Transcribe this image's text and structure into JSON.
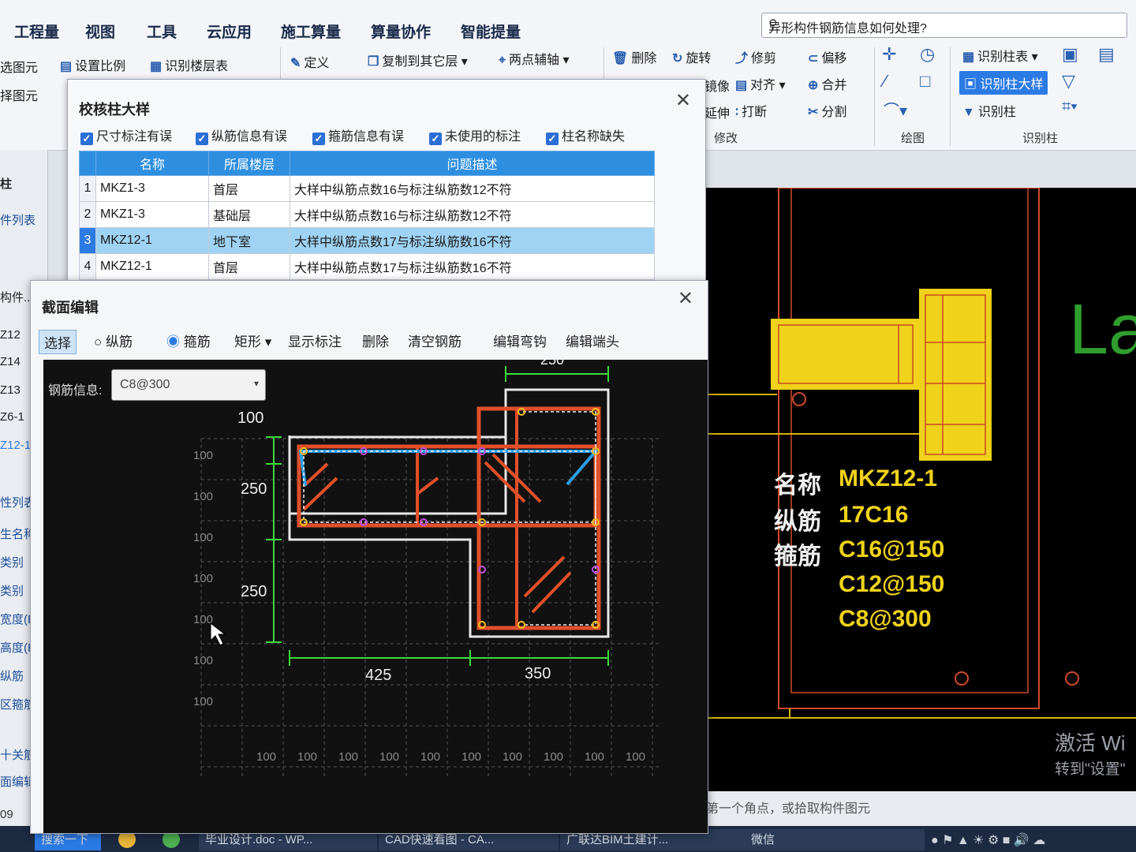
{
  "menu": [
    "工程量",
    "视图",
    "工具",
    "云应用",
    "施工算量",
    "算量协作",
    "智能提量"
  ],
  "search": {
    "text": "异形构件钢筋信息如何处理?"
  },
  "ribbon": {
    "set_scale": "设置比例",
    "identify_floor_table": "识别楼层表",
    "define": "定义",
    "copy_to_other_floor": "复制到其它层",
    "two_point_axis": "两点辅轴",
    "delete": "删除",
    "rotate": "旋转",
    "trim": "修剪",
    "offset": "偏移",
    "mirror": "镜像",
    "align": "对齐",
    "merge": "合并",
    "extend": "延伸",
    "break": "打断",
    "split": "分割",
    "modify_group": "修改",
    "draw_group": "绘图",
    "identify_column_table": "识别柱表",
    "identify_column_detail": "识别柱大样",
    "identify_column": "识别柱",
    "identify_column_group": "识别柱",
    "left_graphic_1": "选图元",
    "left_graphic_2": "择图元"
  },
  "left_panel": [
    "柱",
    "件列表",
    "构件...",
    "Z12",
    "Z14",
    "Z13",
    "Z6-1",
    "Z12-1",
    "性列表",
    "生名称",
    "类别",
    "类别",
    "宽度(B",
    "高度(H",
    "纵筋",
    "区箍筋",
    "十关筋",
    "面编辑",
    "09"
  ],
  "dialog_check": {
    "title": "校核柱大样",
    "checks": [
      "尺寸标注有误",
      "纵筋信息有误",
      "箍筋信息有误",
      "未使用的标注",
      "柱名称缺失"
    ],
    "columns": [
      "名称",
      "所属楼层",
      "问题描述"
    ],
    "rows": [
      {
        "n": "1",
        "name": "MKZ1-3",
        "floor": "首层",
        "desc": "大样中纵筋点数16与标注纵筋数12不符"
      },
      {
        "n": "2",
        "name": "MKZ1-3",
        "floor": "基础层",
        "desc": "大样中纵筋点数16与标注纵筋数12不符"
      },
      {
        "n": "3",
        "name": "MKZ12-1",
        "floor": "地下室",
        "desc": "大样中纵筋点数17与标注纵筋数16不符"
      },
      {
        "n": "4",
        "name": "MKZ12-1",
        "floor": "首层",
        "desc": "大样中纵筋点数17与标注纵筋数16不符"
      }
    ]
  },
  "dialog_section": {
    "title": "截面编辑",
    "toolbar": {
      "select": "选择",
      "longitudinal": "纵筋",
      "stirrup": "箍筋",
      "rect": "矩形",
      "show_label": "显示标注",
      "delete": "删除",
      "clear": "清空钢筋",
      "edit_bend": "编辑弯钩",
      "edit_end": "编辑端头"
    },
    "rebar_info_label": "钢筋信息:",
    "rebar_info_value": "C8@300",
    "dims": {
      "top": "250",
      "left_top": "100",
      "left_mid": "250",
      "left_bot": "250",
      "bottom_left": "425",
      "bottom_right": "350"
    },
    "grid_labels": "100"
  },
  "cad_label": {
    "name_key": "名称",
    "name_val": "MKZ12-1",
    "long_key": "纵筋",
    "long_val": "17C16",
    "stir_key": "箍筋",
    "stir_vals": [
      "C16@150",
      "C12@150",
      "C8@300"
    ],
    "watermark_1": "激活 Wi",
    "watermark_2": "转到\"设置\""
  },
  "status_text": "第一个角点，或拾取构件图元",
  "taskbar": [
    "搜索一下",
    "毕业设计.doc - WP...",
    "CAD快速看图 - CA...",
    "广联达BIM土建计...",
    "微信"
  ]
}
